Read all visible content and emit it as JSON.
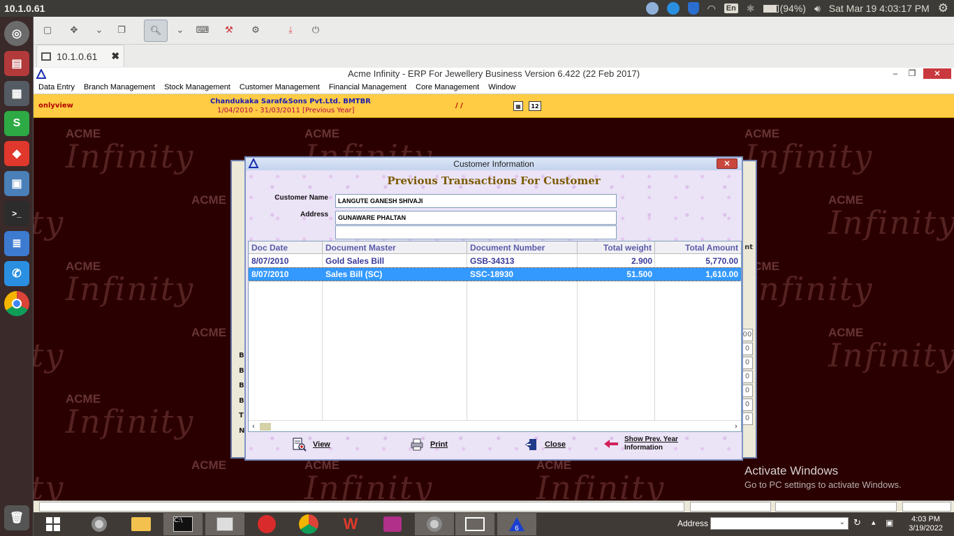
{
  "top_panel": {
    "host": "10.1.0.61",
    "battery": "(94%)",
    "keyboard_lang": "En",
    "datetime": "Sat Mar 19  4:03:17 PM"
  },
  "remmina": {
    "tab_label": "10.1.0.61"
  },
  "app": {
    "title": "Acme Infinity - ERP For Jewellery Business  Version 6.422 (22 Feb 2017)",
    "menu": [
      "Data Entry",
      "Branch Management",
      "Stock Management",
      "Customer Management",
      "Financial Management",
      "Core Management",
      "Window"
    ],
    "mode": "onlyview",
    "company": "Chandukaka Saraf&Sons Pvt.Ltd. BMTBR",
    "period": "1/04/2010 - 31/03/2011 [Previous Year]",
    "slashes": "/ /",
    "calendar_icon_text": "12"
  },
  "watermark": {
    "brand": "ACME",
    "word": "Infinity"
  },
  "background_window": {
    "row_letters": [
      "B",
      "B",
      "B",
      "B",
      "T",
      "N."
    ],
    "cell_values": [
      "00",
      "0",
      "0",
      "0",
      "0",
      "0",
      "0"
    ],
    "header_fragment": "nt"
  },
  "dialog": {
    "title": "Customer  Information",
    "heading": "Previous Transactions  For Customer",
    "customer_name_label": "Customer Name",
    "address_label": "Address",
    "customer_name": "LANGUTE GANESH SHIVAJI",
    "address_line1": "GUNAWARE PHALTAN",
    "address_line2": "",
    "columns": [
      "Doc Date",
      "Document Master",
      "Document Number",
      "Total weight",
      "Total Amount"
    ],
    "rows": [
      {
        "doc_date": "8/07/2010",
        "doc_master": "Gold Sales Bill",
        "doc_number": "GSB-34313",
        "total_weight": "2.900",
        "total_amount": "5,770.00",
        "selected": false
      },
      {
        "doc_date": "8/07/2010",
        "doc_master": "Sales Bill (SC)",
        "doc_number": "SSC-18930",
        "total_weight": "51.500",
        "total_amount": "1,610.00",
        "selected": true
      }
    ],
    "buttons": {
      "view": "View",
      "print": "Print",
      "close": "Close",
      "prev_year_line1": "Show Prev. Year",
      "prev_year_line2": "Information"
    }
  },
  "activate_windows": {
    "line1": "Activate Windows",
    "line2": "Go to PC settings to activate Windows."
  },
  "taskbar": {
    "address_label": "Address",
    "time": "4:03 PM",
    "date": "3/19/2022"
  },
  "colors": {
    "selected_row": "#3399ff",
    "info_bar": "#ffcc44",
    "heading_gold": "#7b5a00",
    "grid_text": "#3a3a9a"
  }
}
